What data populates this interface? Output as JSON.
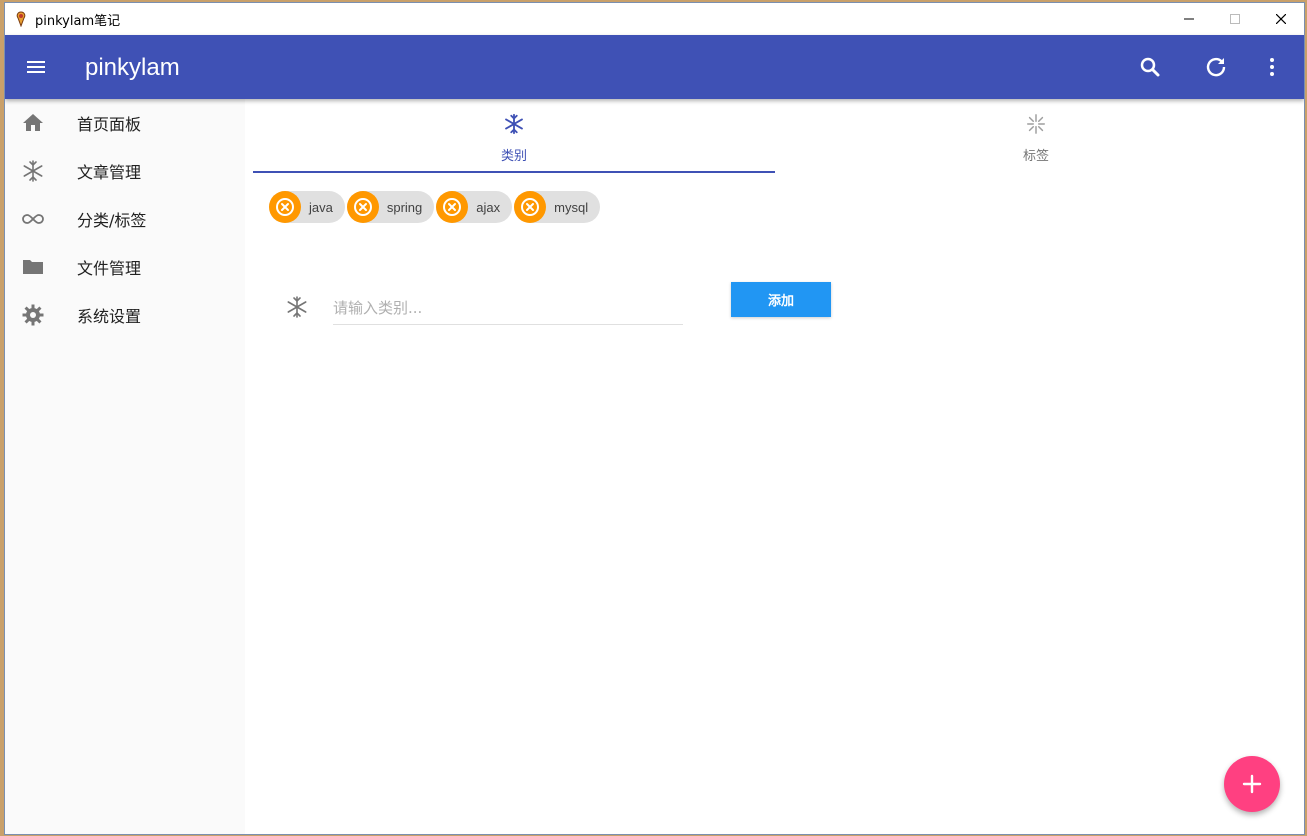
{
  "window": {
    "title": "pinkylam笔记",
    "minimize_icon": "minimize-icon",
    "maximize_icon": "maximize-icon",
    "close_icon": "close-icon"
  },
  "appbar": {
    "title": "pinkylam",
    "background": "#3f51b5",
    "actions": [
      "search-icon",
      "refresh-icon",
      "more-vert-icon"
    ]
  },
  "sidebar": {
    "items": [
      {
        "label": "首页面板",
        "icon": "home-icon"
      },
      {
        "label": "文章管理",
        "icon": "snowflake-icon"
      },
      {
        "label": "分类/标签",
        "icon": "infinity-icon"
      },
      {
        "label": "文件管理",
        "icon": "folder-icon"
      },
      {
        "label": "系统设置",
        "icon": "gear-icon"
      }
    ]
  },
  "tabs": [
    {
      "label": "类别",
      "icon": "snowflake-icon",
      "active": true
    },
    {
      "label": "标签",
      "icon": "sparkle-icon",
      "active": false
    }
  ],
  "chips": [
    {
      "label": "java"
    },
    {
      "label": "spring"
    },
    {
      "label": "ajax"
    },
    {
      "label": "mysql"
    }
  ],
  "form": {
    "placeholder": "请输入类别...",
    "value": "",
    "add_label": "添加"
  },
  "colors": {
    "primary": "#3f51b5",
    "chip_avatar": "#ff9800",
    "add_button": "#2196f3",
    "fab": "#ff4081"
  }
}
